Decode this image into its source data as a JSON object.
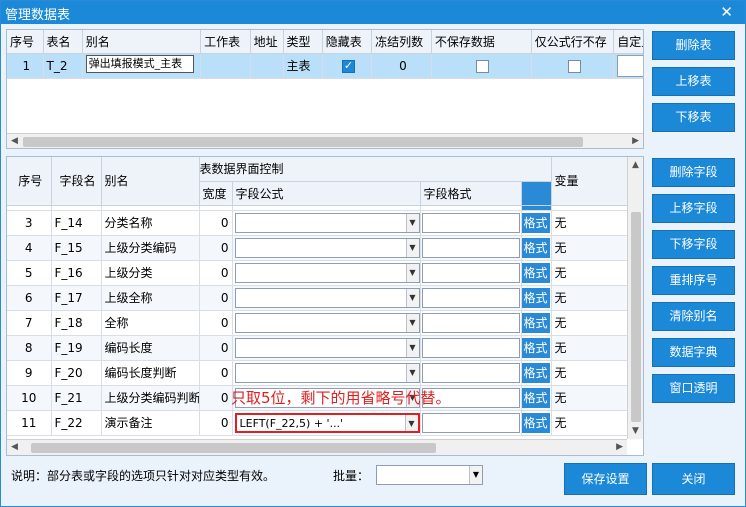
{
  "window": {
    "title": "管理数据表",
    "close_glyph": "✕"
  },
  "tables_grid": {
    "columns": [
      "序号",
      "表名",
      "别名",
      "工作表",
      "地址",
      "类型",
      "隐藏表",
      "冻结列数",
      "不保存数据",
      "仅公式行不存",
      "自定义条件"
    ],
    "rows": [
      {
        "index": "1",
        "name": "T_2",
        "alias": "弹出填报模式_主表",
        "sheet": "",
        "address": "",
        "type": "主表",
        "hidden": true,
        "frozen_cols": "0",
        "no_save": false,
        "formula_only": false,
        "custom_cond": ""
      }
    ]
  },
  "fields_grid": {
    "group_header": "表数据界面控制",
    "columns": {
      "index": "序号",
      "field": "字段名",
      "alias": "别名",
      "width": "宽度",
      "formula": "字段公式",
      "format": "字段格式",
      "variable": "变量"
    },
    "format_button_label": "格式",
    "rows": [
      {
        "index": "3",
        "field": "F_14",
        "alias": "分类名称",
        "width": "0",
        "formula": "",
        "variable": "无"
      },
      {
        "index": "4",
        "field": "F_15",
        "alias": "上级分类编码",
        "width": "0",
        "formula": "",
        "variable": "无"
      },
      {
        "index": "5",
        "field": "F_16",
        "alias": "上级分类",
        "width": "0",
        "formula": "",
        "variable": "无"
      },
      {
        "index": "6",
        "field": "F_17",
        "alias": "上级全称",
        "width": "0",
        "formula": "",
        "variable": "无"
      },
      {
        "index": "7",
        "field": "F_18",
        "alias": "全称",
        "width": "0",
        "formula": "",
        "variable": "无"
      },
      {
        "index": "8",
        "field": "F_19",
        "alias": "编码长度",
        "width": "0",
        "formula": "",
        "variable": "无"
      },
      {
        "index": "9",
        "field": "F_20",
        "alias": "编码长度判断",
        "width": "0",
        "formula": "",
        "variable": "无"
      },
      {
        "index": "10",
        "field": "F_21",
        "alias": "上级分类编码判断",
        "width": "0",
        "formula": "",
        "variable": "无"
      },
      {
        "index": "11",
        "field": "F_22",
        "alias": "演示备注",
        "width": "0",
        "formula": "LEFT(F_22,5) + '...'",
        "variable": "无"
      }
    ]
  },
  "annotation": "只取5位，剩下的用省略号代替。",
  "table_buttons": {
    "delete": "删除表",
    "move_up": "上移表",
    "move_down": "下移表"
  },
  "field_buttons": {
    "delete": "删除字段",
    "move_up": "上移字段",
    "move_down": "下移字段",
    "renumber": "重排序号",
    "clear_alias": "清除别名",
    "dictionary": "数据字典",
    "transparent": "窗口透明"
  },
  "footer": {
    "note": "说明：部分表或字段的选项只针对对应类型有效。",
    "batch_label": "批量：",
    "batch_value": "",
    "save": "保存设置",
    "close": "关闭"
  },
  "colors": {
    "accent": "#1c89d8",
    "highlight": "#e02020",
    "selected_row": "#b9e0f8"
  },
  "icons": {
    "dropdown": "dropdown-arrow-icon",
    "checkbox": "checkbox-icon",
    "close": "close-icon"
  }
}
